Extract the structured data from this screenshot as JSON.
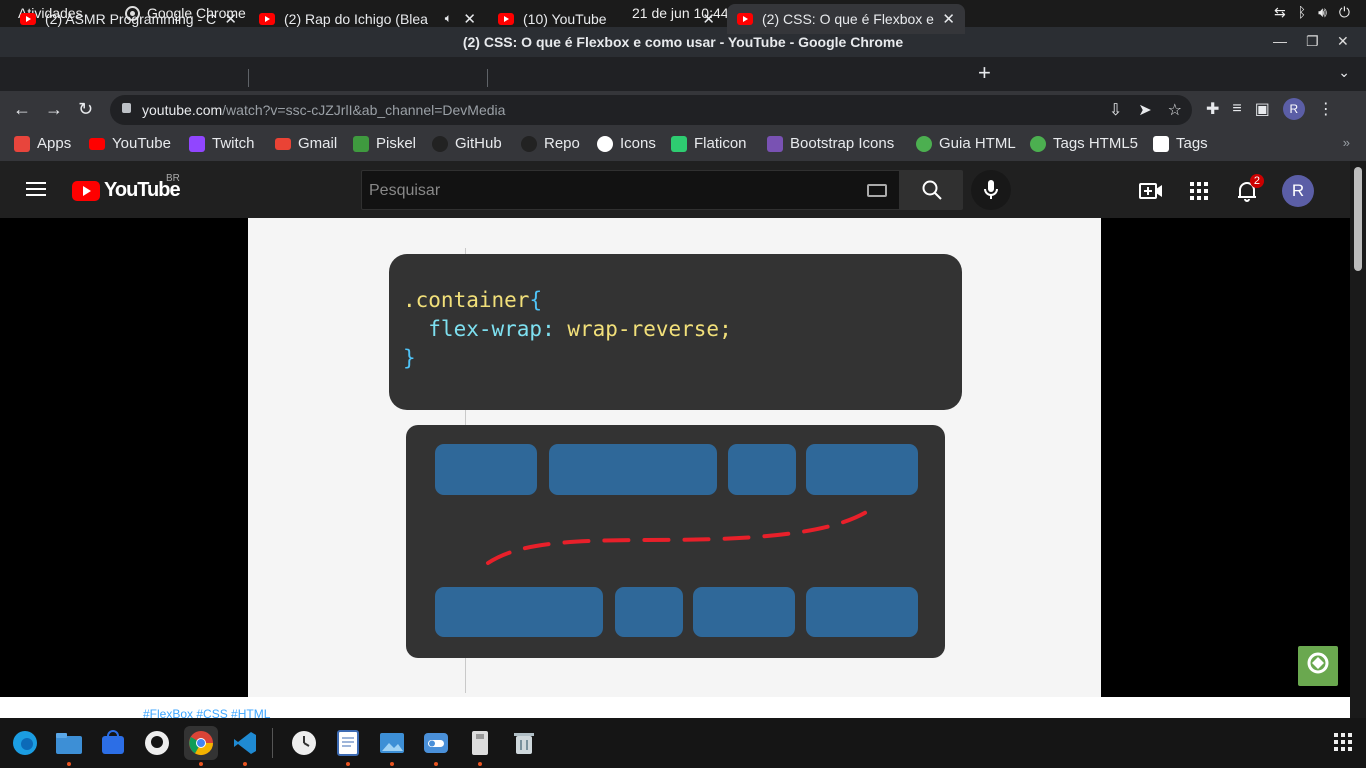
{
  "system": {
    "activities": "Atividades",
    "app_name": "Google Chrome",
    "clock": "21 de jun  10:44"
  },
  "window": {
    "title": "(2) CSS: O que é Flexbox e como usar - YouTube - Google Chrome"
  },
  "tabs": [
    {
      "label": "(2) ASMR Programming - C",
      "active": false
    },
    {
      "label": "(2) Rap do Ichigo (Blea",
      "active": false,
      "audio": true
    },
    {
      "label": "(10) YouTube",
      "active": false
    },
    {
      "label": "(2) CSS: O que é Flexbox e",
      "active": true
    }
  ],
  "omnibox": {
    "host": "youtube.com",
    "path": "/watch?v=ssc-cJZJrlI&ab_channel=DevMedia"
  },
  "profile_initial": "R",
  "bookmarks": [
    {
      "label": "Apps",
      "color": "#e8453c"
    },
    {
      "label": "YouTube",
      "color": "#ff0000"
    },
    {
      "label": "Twitch",
      "color": "#9146ff"
    },
    {
      "label": "Gmail",
      "color": "#ea4335"
    },
    {
      "label": "Piskel",
      "color": "#3f9a3f"
    },
    {
      "label": "GitHub",
      "color": "#222222"
    },
    {
      "label": "Repo",
      "color": "#222222"
    },
    {
      "label": "Icons",
      "color": "#ffffff"
    },
    {
      "label": "Flaticon",
      "color": "#2ecc71"
    },
    {
      "label": "Bootstrap Icons",
      "color": "#7952b3"
    },
    {
      "label": "Guia HTML",
      "color": "#4caf50"
    },
    {
      "label": "Tags HTML5",
      "color": "#4caf50"
    },
    {
      "label": "Tags",
      "color": "#ffffff"
    }
  ],
  "youtube": {
    "logo_text": "YouTube",
    "region": "BR",
    "search_placeholder": "Pesquisar",
    "notification_count": "2",
    "avatar_initial": "R"
  },
  "video": {
    "code_line1_selector": ".container",
    "code_line1_brace": "{",
    "code_line2_prop": "  flex-wrap:",
    "code_line2_value": " wrap-reverse;",
    "code_line3_brace": "}"
  },
  "description_tags": "#FlexBox #CSS #HTML",
  "colors": {
    "flex_item": "#2f6899",
    "code_bg": "#333333",
    "arrow": "#e8202a"
  }
}
